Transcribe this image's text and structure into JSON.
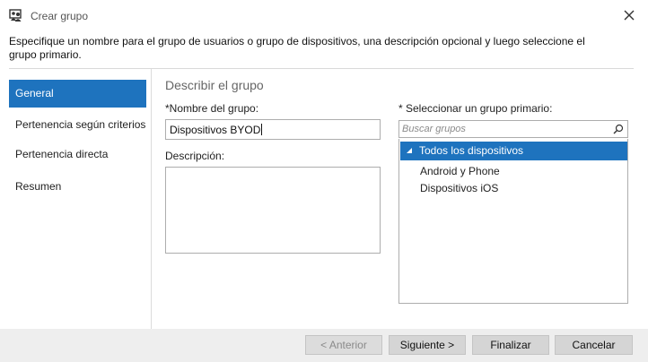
{
  "window": {
    "title": "Crear grupo",
    "icon": "users-group-icon",
    "close_icon": "close-icon"
  },
  "intro_text": "Especifique un nombre para el grupo de usuarios o grupo de dispositivos, una descripción opcional y luego seleccione el grupo primario.",
  "nav": {
    "items": [
      {
        "label": "General",
        "selected": true
      },
      {
        "label": "Pertenencia según criterios",
        "selected": false
      },
      {
        "label": "Pertenencia directa",
        "selected": false
      },
      {
        "label": "Resumen",
        "selected": false
      }
    ]
  },
  "main": {
    "section_title": "Describir el grupo",
    "name_label": "*Nombre del grupo:",
    "name_value": "Dispositivos BYOD",
    "description_label": "Descripción:",
    "description_value": "",
    "parent_label": "* Seleccionar un grupo primario:",
    "search_placeholder": "Buscar grupos",
    "tree": {
      "root": {
        "label": "Todos los dispositivos",
        "expanded": true,
        "selected": true
      },
      "children": [
        {
          "label": "Android y Phone"
        },
        {
          "label": "Dispositivos iOS"
        }
      ]
    }
  },
  "footer": {
    "back_label": "< Anterior",
    "back_enabled": false,
    "next_label": "Siguiente >",
    "finish_label": "Finalizar",
    "cancel_label": "Cancelar"
  },
  "colors": {
    "accent": "#1e73be",
    "footer_bg": "#eeeeee",
    "button_bg": "#d5d5d5"
  }
}
